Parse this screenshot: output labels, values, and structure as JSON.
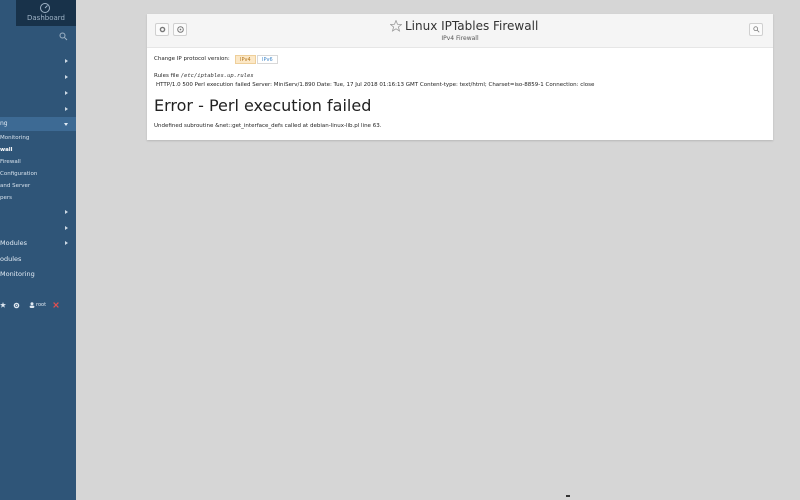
{
  "sidebar": {
    "dashboard_label": "Dashboard",
    "active_category": "ng",
    "submenu": [
      {
        "label": "Monitoring"
      },
      {
        "label": "wall"
      },
      {
        "label": "Firewall"
      },
      {
        "label": "Configuration"
      },
      {
        "label": "and Server"
      },
      {
        "label": "pers"
      }
    ],
    "modules": [
      {
        "label": "Modules"
      },
      {
        "label": "odules"
      },
      {
        "label": "Monitoring"
      }
    ],
    "user_label": "root"
  },
  "panel": {
    "title": "Linux IPTables Firewall",
    "subtitle": "IPv4 Firewall",
    "protocol_label": "Change IP protocol version:",
    "protocol_options": [
      "IPv4",
      "IPv6"
    ],
    "protocol_selected": "IPv4",
    "rules_label": "Rules file",
    "rules_path": "/etc/iptables.up.rules",
    "http_line": "HTTP/1.0 500 Perl execution failed Server: MiniServ/1.890 Date: Tue, 17 Jul 2018 01:16:13 GMT Content-type: text/html; Charset=iso-8859-1 Connection: close",
    "error_title": "Error - Perl execution failed",
    "error_detail": "Undefined subroutine &net::get_interface_defs called at debian-linux-lib.pl line 63."
  },
  "colors": {
    "sidebar_bg": "#2f5578",
    "page_bg": "#d6d6d6",
    "active_protocol_bg": "#fce8c7",
    "inactive_protocol_text": "#3f86c8"
  },
  "icons": {
    "dashboard": "dashboard-icon",
    "search": "search-icon",
    "gear": "gear-icon",
    "help": "help-icon",
    "star": "star-icon",
    "user": "user-icon",
    "logout": "logout-icon"
  }
}
